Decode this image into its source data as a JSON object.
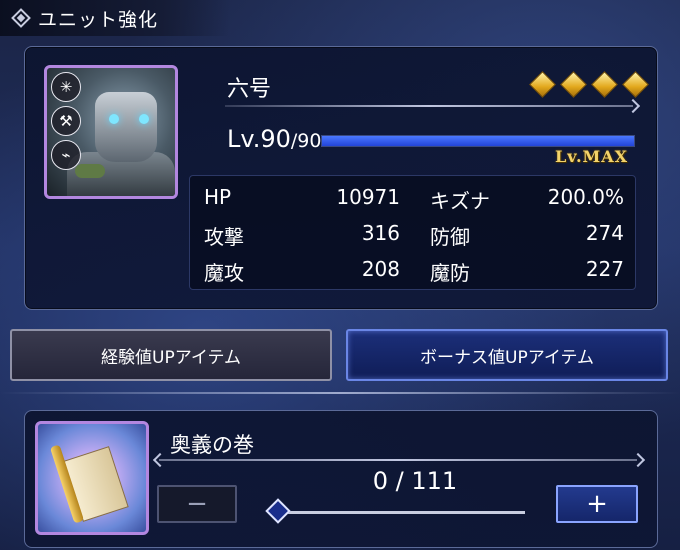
{
  "header": {
    "title": "ユニット強化"
  },
  "unit": {
    "name": "六号",
    "rank": 4,
    "level": "Lv.90",
    "level_max": "/90",
    "exp_progress": 1.0,
    "level_status": "Lv.MAX",
    "portrait_badges": [
      "✳",
      "⚒",
      "⌁"
    ],
    "stats": [
      {
        "label": "HP",
        "value": "10971"
      },
      {
        "label": "キズナ",
        "value": "200.0%"
      },
      {
        "label": "攻撃",
        "value": "316"
      },
      {
        "label": "防御",
        "value": "274"
      },
      {
        "label": "魔攻",
        "value": "208"
      },
      {
        "label": "魔防",
        "value": "227"
      }
    ]
  },
  "tabs": {
    "exp_item_label": "経験値UPアイテム",
    "bonus_item_label": "ボーナス値UPアイテム"
  },
  "item": {
    "name": "奥義の巻",
    "count": "0 / 111",
    "selected_fraction": 0,
    "minus_label": "−",
    "plus_label": "+"
  },
  "colors": {
    "accent_blue": "#2244d8",
    "gold": "#f3d36a",
    "rarity_purple": "#b387e0"
  }
}
